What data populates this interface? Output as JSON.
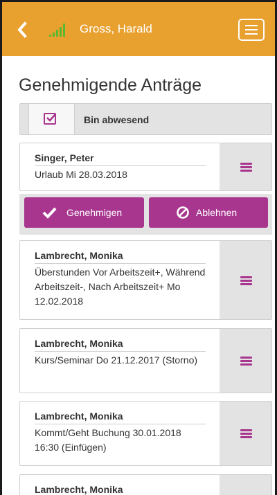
{
  "header": {
    "user_name": "Gross, Harald",
    "icons": [
      "chevron-left-icon",
      "signal-strength-icon",
      "hamburger-menu-icon"
    ],
    "colors": {
      "bar": "#e8a02e",
      "signal": "#5cb82e"
    }
  },
  "page": {
    "title": "Genehmigende Anträge"
  },
  "absent": {
    "label": "Bin abwesend",
    "checked": true
  },
  "actions": {
    "approve_label": "Genehmigen",
    "reject_label": "Ablehnen"
  },
  "accent_color": "#a8368f",
  "requests": [
    {
      "name": "Singer, Peter",
      "detail": "Urlaub Mi 28.03.2018"
    },
    {
      "name": "Lambrecht, Monika",
      "detail": "Überstunden Vor Arbeitszeit+, Während Arbeitszeit-, Nach Arbeitszeit+ Mo 12.02.2018"
    },
    {
      "name": "Lambrecht, Monika",
      "detail": "Kurs/Seminar Do 21.12.2017 (Storno)"
    },
    {
      "name": "Lambrecht, Monika",
      "detail": "Kommt/Geht Buchung 30.01.2018 16:30 (Einfügen)"
    },
    {
      "name": "Lambrecht, Monika",
      "detail": ""
    }
  ]
}
